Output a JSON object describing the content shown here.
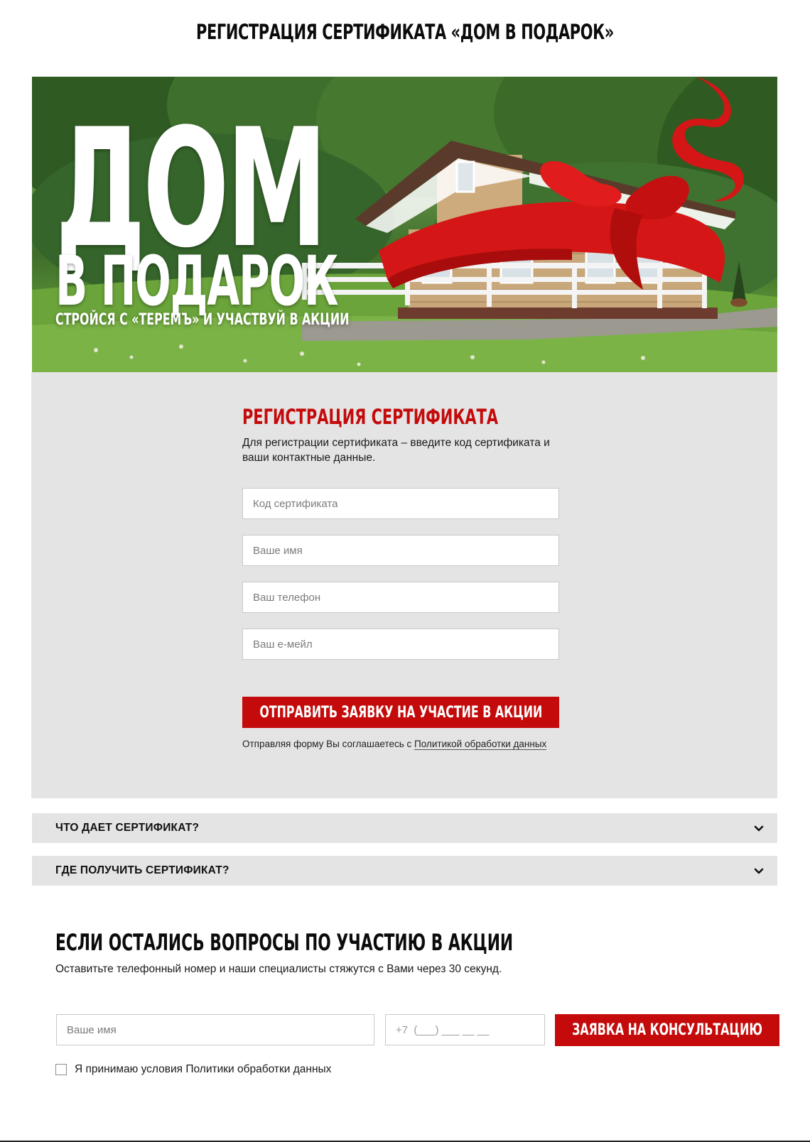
{
  "page": {
    "title": "РЕГИСТРАЦИЯ СЕРТИФИКАТА «ДОМ В ПОДАРОК»"
  },
  "banner": {
    "title_line1": "ДОМ",
    "title_line2": "В ПОДАРОК",
    "subtitle": "СТРОЙСЯ С «ТЕРЕМЪ» И УЧАСТВУЙ В АКЦИИ"
  },
  "registration": {
    "heading": "РЕГИСТРАЦИЯ СЕРТИФИКАТА",
    "description": "Для регистрации сертификата – введите код сертификата и ваши контактные данные.",
    "fields": {
      "code_placeholder": "Код сертификата",
      "name_placeholder": "Ваше имя",
      "phone_placeholder": "Ваш телефон",
      "email_placeholder": "Ваш е-мейл"
    },
    "submit_label": "ОТПРАВИТЬ ЗАЯВКУ НА УЧАСТИЕ В АКЦИИ",
    "consent_text": "Отправляя форму Вы соглашаетесь с",
    "consent_link": "Политикой обработки данных"
  },
  "faq": [
    {
      "label": "ЧТО ДАЕТ СЕРТИФИКАТ?",
      "icon": "chevron-down-icon"
    },
    {
      "label": "ГДЕ ПОЛУЧИТЬ СЕРТИФИКАТ?",
      "icon": "chevron-down-icon"
    }
  ],
  "consult": {
    "heading": "ЕСЛИ ОСТАЛИСЬ ВОПРОСЫ ПО УЧАСТИЮ В АКЦИИ",
    "description": "Оставитьте телефонный номер и наши специалисты стяжутся с Вами через 30 секунд.",
    "name_placeholder": "Ваше имя",
    "phone_value": "+7  (___) ___ __ __",
    "button_label": "ЗАЯВКА НА КОНСУЛЬТАЦИЮ",
    "checkbox_label": "Я принимаю условия Политики обработки данных"
  },
  "colors": {
    "accent": "#c40a0a",
    "panel": "#e4e4e4"
  }
}
